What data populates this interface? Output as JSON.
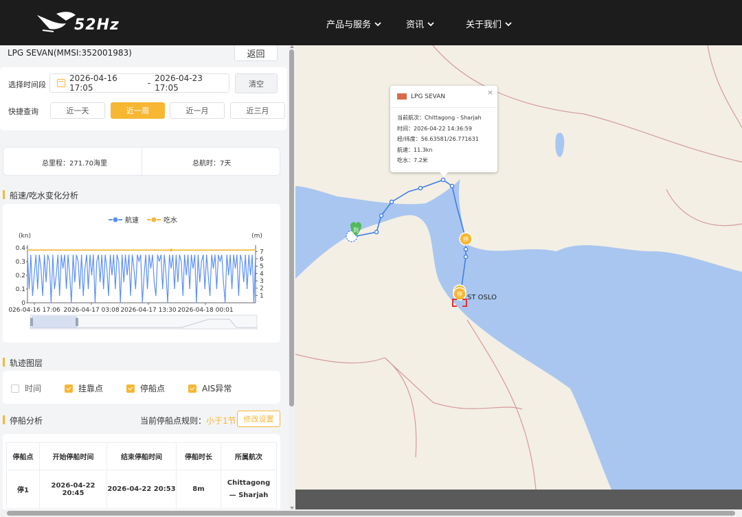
{
  "header": {
    "logo_text": "52Hz",
    "nav": [
      {
        "label": "产品与服务"
      },
      {
        "label": "资讯"
      },
      {
        "label": "关于我们"
      }
    ]
  },
  "ship": {
    "title": "LPG SEVAN(MMSI:352001983)",
    "back_label": "返回"
  },
  "time_filter": {
    "label": "选择时间段",
    "start": "2026-04-16 17:05",
    "separator": "-",
    "end": "2026-04-23 17:05",
    "clear_label": "清空",
    "quick_label": "快捷查询",
    "quick": [
      {
        "label": "近一天",
        "active": false
      },
      {
        "label": "近一周",
        "active": true
      },
      {
        "label": "近一月",
        "active": false
      },
      {
        "label": "近三月",
        "active": false
      }
    ]
  },
  "summary": {
    "distance": "总里程：271.70海里",
    "duration": "总航时：7天"
  },
  "speed_section": {
    "title": "船速/吃水变化分析"
  },
  "chart_data": {
    "type": "line",
    "legend": [
      {
        "name": "航速",
        "color": "#5b8ff9"
      },
      {
        "name": "吃水",
        "color": "#f7b733"
      }
    ],
    "y_left_label": "(kn)",
    "y_right_label": "(m)",
    "y_left_ticks": [
      "0",
      "0.1",
      "0.2",
      "0.3",
      "0.4"
    ],
    "y_right_ticks": [
      "1",
      "2",
      "3",
      "4",
      "5",
      "6",
      "7"
    ],
    "y_left_range": [
      0,
      0.4
    ],
    "y_right_range": [
      0,
      7.5
    ],
    "x_ticks": [
      "026-04-16 17:06",
      "2026-04-17 03:08",
      "2026-04-17 13:30",
      "2026-04-18 00:01"
    ],
    "series": [
      {
        "name": "航速",
        "values": [
          0.35,
          0.1,
          0.35,
          0.05,
          0.2,
          0.35,
          0.1,
          0.35,
          0.25,
          0.05,
          0.35,
          0.15,
          0.35,
          0.3,
          0.0,
          0.35,
          0.1,
          0.2,
          0.35,
          0.05,
          0.35,
          0.25,
          0.35,
          0.1,
          0.35,
          0.2,
          0.0,
          0.35,
          0.15,
          0.35,
          0.3,
          0.1,
          0.35,
          0.05,
          0.25,
          0.35,
          0.1,
          0.35,
          0.2,
          0.35,
          0.0,
          0.3,
          0.35,
          0.15,
          0.35,
          0.1,
          0.35,
          0.25,
          0.05,
          0.35,
          0.2,
          0.35,
          0.1,
          0.35,
          0.3,
          0.0,
          0.35,
          0.15,
          0.35,
          0.2,
          0.35,
          0.05,
          0.35,
          0.25,
          0.1,
          0.35,
          0.3,
          0.35,
          0.0,
          0.2,
          0.35,
          0.1,
          0.35,
          0.25,
          0.35,
          0.15,
          0.05,
          0.35,
          0.3,
          0.35,
          0.1,
          0.35,
          0.2,
          0.0,
          0.35,
          0.25,
          0.35,
          0.1,
          0.35,
          0.15,
          0.35,
          0.3,
          0.05,
          0.35,
          0.2,
          0.35,
          0.1,
          0.35,
          0.25,
          0.35,
          0.0,
          0.35,
          0.15,
          0.3,
          0.35,
          0.1,
          0.35,
          0.2,
          0.05,
          0.35,
          0.25,
          0.35,
          0.1,
          0.35,
          0.3,
          0.35,
          0.15,
          0.0,
          0.35,
          0.2,
          0.35,
          0.1,
          0.35,
          0.25,
          0.35,
          0.05,
          0.35,
          0.3,
          0.15,
          0.35,
          0.1,
          0.35,
          0.2,
          0.35,
          0.0,
          0.35
        ]
      },
      {
        "name": "吃水",
        "value": 7.2
      }
    ]
  },
  "layers": {
    "title": "轨迹图层",
    "items": [
      {
        "label": "时间",
        "checked": false
      },
      {
        "label": "挂靠点",
        "checked": true
      },
      {
        "label": "停船点",
        "checked": true
      },
      {
        "label": "AIS异常",
        "checked": true
      }
    ]
  },
  "stops": {
    "title": "停船分析",
    "rule_label": "当前停船点规则：",
    "rule_value": "小于1节",
    "modify_label": "修改设置",
    "columns": [
      "停船点",
      "开始停船时间",
      "结束停船时间",
      "停船时长",
      "所属航次"
    ],
    "rows": [
      {
        "id": "停1",
        "start": "2026-04-22 20:45",
        "end": "2026-04-22 20:53",
        "duration": "8m",
        "voyage_a": "Chittagong",
        "voyage_b": "— Sharjah"
      }
    ]
  },
  "popup": {
    "name": "LPG SEVAN",
    "close": "×",
    "voyage": "当前航次：Chittagong - Sharjah",
    "time": "时间：2026-04-22 14:36:59",
    "position": "经/纬度：56.63581/26.771631",
    "speed": "航速：11.3kn",
    "draft": "吃水：7.2米"
  },
  "map": {
    "arrive_marker": "到",
    "stop_marker": "停",
    "target_label": "ST OSLO",
    "colors": {
      "water": "#a9c6f0",
      "land": "#f3efe4",
      "track": "#3f7ee8",
      "accent": "#f7b733"
    }
  }
}
